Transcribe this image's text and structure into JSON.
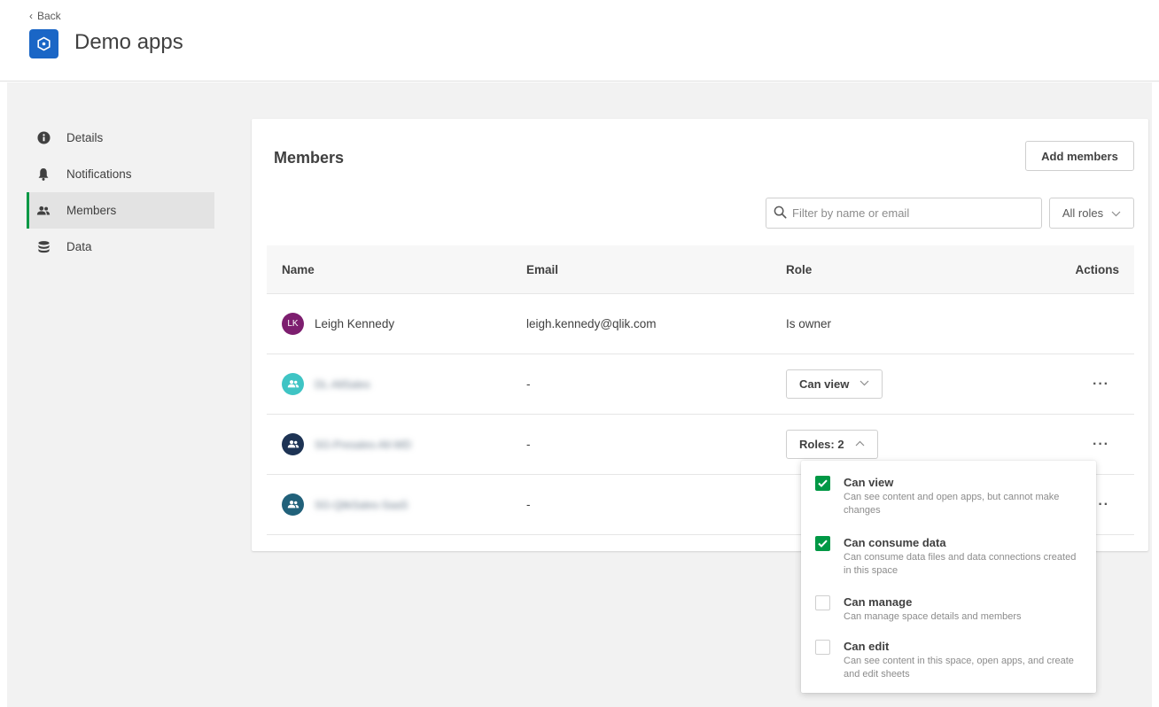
{
  "header": {
    "back_label": "Back",
    "title": "Demo apps",
    "icon": "space-icon"
  },
  "sidebar": {
    "items": [
      {
        "label": "Details",
        "icon": "info-icon",
        "active": false
      },
      {
        "label": "Notifications",
        "icon": "bell-icon",
        "active": false
      },
      {
        "label": "Members",
        "icon": "users-icon",
        "active": true
      },
      {
        "label": "Data",
        "icon": "database-icon",
        "active": false
      }
    ]
  },
  "members": {
    "title": "Members",
    "add_button": "Add members",
    "filter_placeholder": "Filter by name or email",
    "roles_filter": "All roles",
    "columns": {
      "name": "Name",
      "email": "Email",
      "role": "Role",
      "actions": "Actions"
    },
    "rows": [
      {
        "initials": "LK",
        "name": "Leigh Kennedy",
        "email": "leigh.kennedy@qlik.com",
        "role": "Is owner",
        "avatar_color": "#7d1e6f",
        "blurred": false
      },
      {
        "initials": "",
        "name": "DL-AllSales",
        "email": "-",
        "role": "Can view",
        "avatar_color": "#3fc4c4",
        "blurred": true
      },
      {
        "initials": "",
        "name": "SG-Presales-All-WD",
        "email": "-",
        "role": "Roles: 2",
        "avatar_color": "#1d3354",
        "blurred": true
      },
      {
        "initials": "",
        "name": "SG-QlikSales-SaaS",
        "email": "-",
        "role": "",
        "avatar_color": "#21617a",
        "blurred": true
      }
    ]
  },
  "role_popover": {
    "options": [
      {
        "label": "Can view",
        "desc": "Can see content and open apps, but cannot make changes",
        "checked": true
      },
      {
        "label": "Can consume data",
        "desc": "Can consume data files and data connections created in this space",
        "checked": true
      },
      {
        "label": "Can manage",
        "desc": "Can manage space details and members",
        "checked": false
      },
      {
        "label": "Can edit",
        "desc": "Can see content in this space, open apps, and create and edit sheets",
        "checked": false
      }
    ]
  },
  "colors": {
    "accent": "#009845",
    "space_icon_bg": "#1a66c6"
  }
}
